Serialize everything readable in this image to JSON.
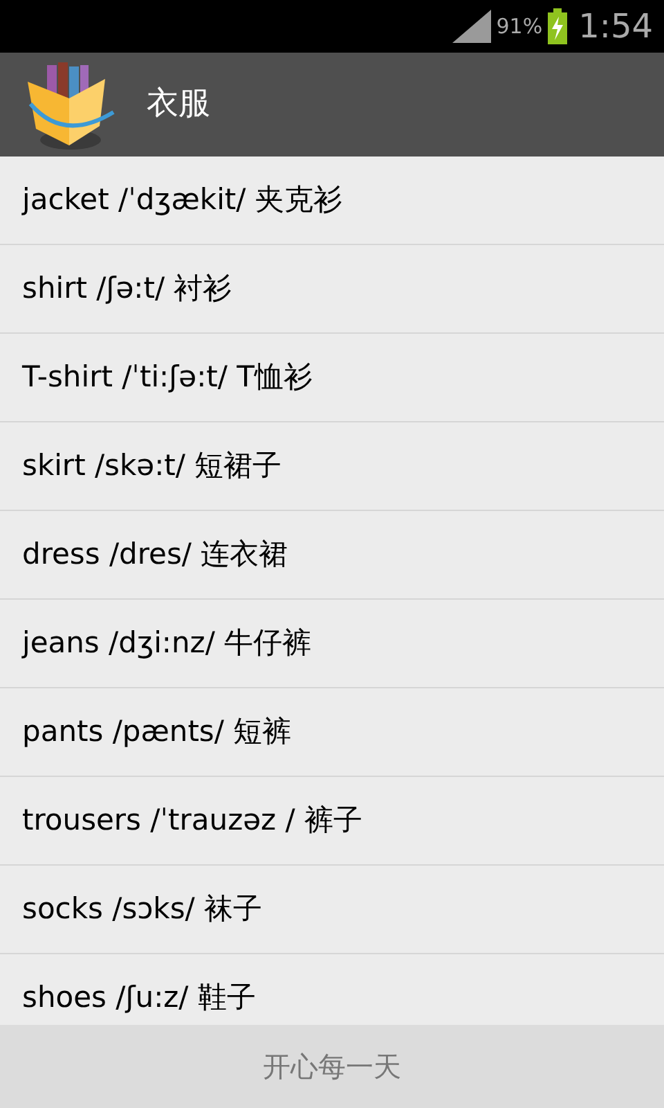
{
  "status_bar": {
    "battery": "91%",
    "time": "1:54"
  },
  "app_bar": {
    "title": "衣服"
  },
  "words": [
    {
      "text": "jacket /ˈdʒækit/ 夹克衫"
    },
    {
      "text": "shirt /ʃə:t/ 衬衫"
    },
    {
      "text": "T-shirt /ˈti:ʃə:t/ T恤衫"
    },
    {
      "text": "skirt /skə:t/ 短裙子"
    },
    {
      "text": "dress /dres/ 连衣裙"
    },
    {
      "text": "jeans /dʒi:nz/ 牛仔裤"
    },
    {
      "text": "pants /pænts/ 短裤"
    },
    {
      "text": "trousers /ˈtrauzəz / 裤子"
    },
    {
      "text": "socks /sɔks/ 袜子"
    },
    {
      "text": "shoes /ʃu:z/ 鞋子"
    }
  ],
  "footer": {
    "text": "开心每一天"
  }
}
